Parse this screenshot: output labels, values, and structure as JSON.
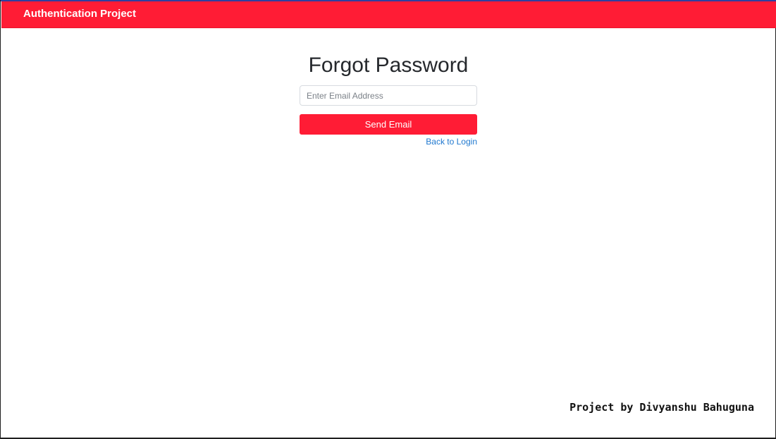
{
  "navbar": {
    "brand": "Authentication Project"
  },
  "main": {
    "title": "Forgot Password",
    "email_input": {
      "value": "",
      "placeholder": "Enter Email Address"
    },
    "send_button_label": "Send Email",
    "back_link_label": "Back to Login"
  },
  "footer": {
    "credit": "Project by Divyanshu Bahuguna"
  },
  "colors": {
    "primary": "#ff1c35",
    "link": "#1f78cf",
    "text": "#25282c"
  }
}
